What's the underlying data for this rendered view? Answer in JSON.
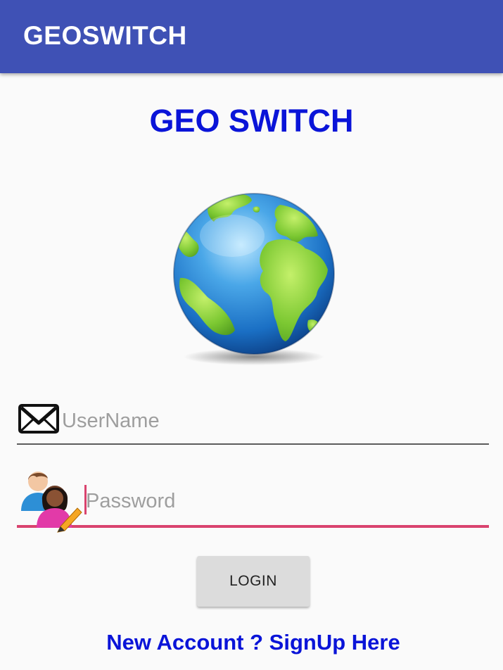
{
  "app_bar": {
    "title": "GEOSWITCH"
  },
  "header": {
    "title": "GEO SWITCH"
  },
  "login_form": {
    "username": {
      "placeholder": "UserName",
      "value": "",
      "icon": "mail-icon"
    },
    "password": {
      "placeholder": "Password",
      "value": "",
      "icon": "users-edit-icon"
    },
    "login_button_label": "LOGIN",
    "signup_link_text": "New Account ? SignUp Here"
  },
  "colors": {
    "app_bar": "#3f51b5",
    "heading": "#0a14d8",
    "accent": "#d9436e",
    "button": "#dcdcdc",
    "background": "#fafafa"
  }
}
